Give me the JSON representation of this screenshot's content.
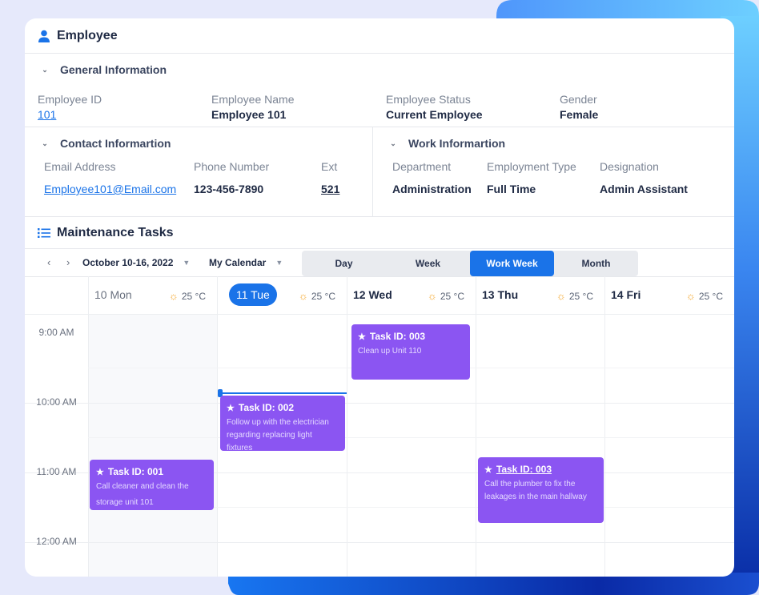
{
  "colors": {
    "accent": "#1a73e8",
    "task": "#8b55f2",
    "page_bg": "#e6e9fb"
  },
  "employee": {
    "icon": "user-icon",
    "title": "Employee",
    "general": {
      "title": "General Information",
      "fields": [
        {
          "label": "Employee ID",
          "value": "101"
        },
        {
          "label": "Employee Name",
          "value": "Employee 101"
        },
        {
          "label": "Employee Status",
          "value": "Current Employee"
        },
        {
          "label": "Gender",
          "value": "Female"
        }
      ]
    },
    "contact": {
      "title": "Contact Informartion",
      "fields": [
        {
          "label": "Email Address",
          "value": "Employee101@Email.com"
        },
        {
          "label": "Phone Number",
          "value": "123-456-7890"
        },
        {
          "label": "Ext",
          "value": "521"
        }
      ]
    },
    "work": {
      "title": "Work Informartion",
      "fields": [
        {
          "label": "Department",
          "value": "Administration"
        },
        {
          "label": "Employment Type",
          "value": "Full Time"
        },
        {
          "label": "Designation",
          "value": "Admin Assistant"
        }
      ]
    }
  },
  "tasks": {
    "icon": "list-icon",
    "title": "Maintenance Tasks",
    "toolbar": {
      "prev": "‹",
      "next": "›",
      "date_range": "October 10-16, 2022",
      "calendar": "My Calendar",
      "views": [
        "Day",
        "Week",
        "Work Week",
        "Month"
      ],
      "active_view": "Work Week"
    },
    "days": [
      {
        "label": "10 Mon",
        "weather": "25 °C",
        "state": "muted"
      },
      {
        "label": "11 Tue",
        "weather": "25 °C",
        "state": "today"
      },
      {
        "label": "12 Wed",
        "weather": "25 °C",
        "state": "normal"
      },
      {
        "label": "13 Thu",
        "weather": "25 °C",
        "state": "normal"
      },
      {
        "label": "14 Fri",
        "weather": "25 °C",
        "state": "normal"
      }
    ],
    "times": [
      "9:00 AM",
      "10:00 AM",
      "11:00 AM",
      "12:00 AM"
    ],
    "events": [
      {
        "title": "Task ID: 003",
        "desc": "Clean up Unit 110"
      },
      {
        "title": "Task ID: 002",
        "desc": "Follow up with the electrician regarding replacing light fixtures"
      },
      {
        "title": "Task ID: 001",
        "desc": "Call cleaner and clean the storage unit 101"
      },
      {
        "title": "Task ID: 003",
        "desc": "Call the plumber to fix the leakages in the main hallway"
      }
    ]
  }
}
